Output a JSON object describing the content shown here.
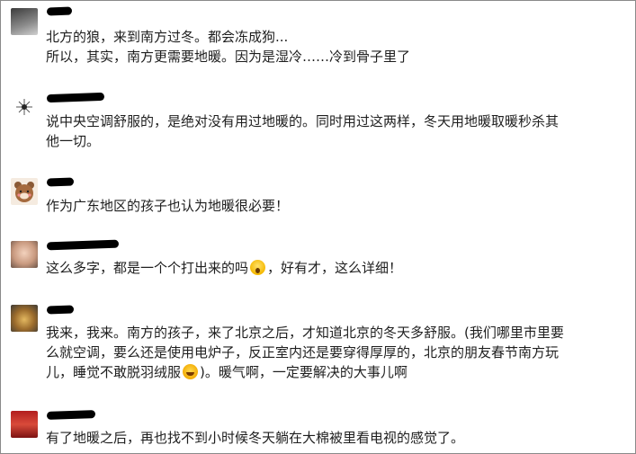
{
  "comments": [
    {
      "name": "",
      "lines": [
        "北方的狼，来到南方过冬。都会冻成狗...",
        "所以，其实，南方更需要地暖。因为是湿冷……冷到骨子里了"
      ],
      "avatar": "avatar-photo-dark"
    },
    {
      "name": "",
      "lines": [
        "说中央空调舒服的，是绝对没有用过地暖的。同时用过这两样，冬天用地暖取暖秒杀其",
        "他一切。"
      ],
      "avatar": "avatar-sparkle"
    },
    {
      "name": "",
      "lines": [
        "作为广东地区的孩子也认为地暖很必要！"
      ],
      "avatar": "avatar-bear"
    },
    {
      "name": "",
      "line_a": "这么多字，都是一个个打出来的吗",
      "line_b": "，好有才，这么详细！",
      "avatar": "avatar-child"
    },
    {
      "name": "",
      "line1": "我来，我来。南方的孩子，来了北京之后，才知道北京的冬天多舒服。(我们哪里市里要",
      "line2": "么就空调，要么还是使用电炉子，反正室内还是要穿得厚厚的，北京的朋友春节南方玩",
      "line3_a": "儿，睡觉不敢脱羽绒服",
      "line3_b": ")。暖气啊，一定要解决的大事儿啊",
      "avatar": "avatar-flowers"
    },
    {
      "name": "",
      "lines": [
        "有了地暖之后，再也找不到小时候冬天躺在大棉被里看电视的感觉了。"
      ],
      "avatar": "avatar-red-scene"
    }
  ],
  "emoji": {
    "scream": "scream-emoji",
    "sweat": "sweat-smile-emoji"
  },
  "colors": {
    "text": "#1e1e1e",
    "name": "#777777",
    "redaction": "#000000"
  }
}
